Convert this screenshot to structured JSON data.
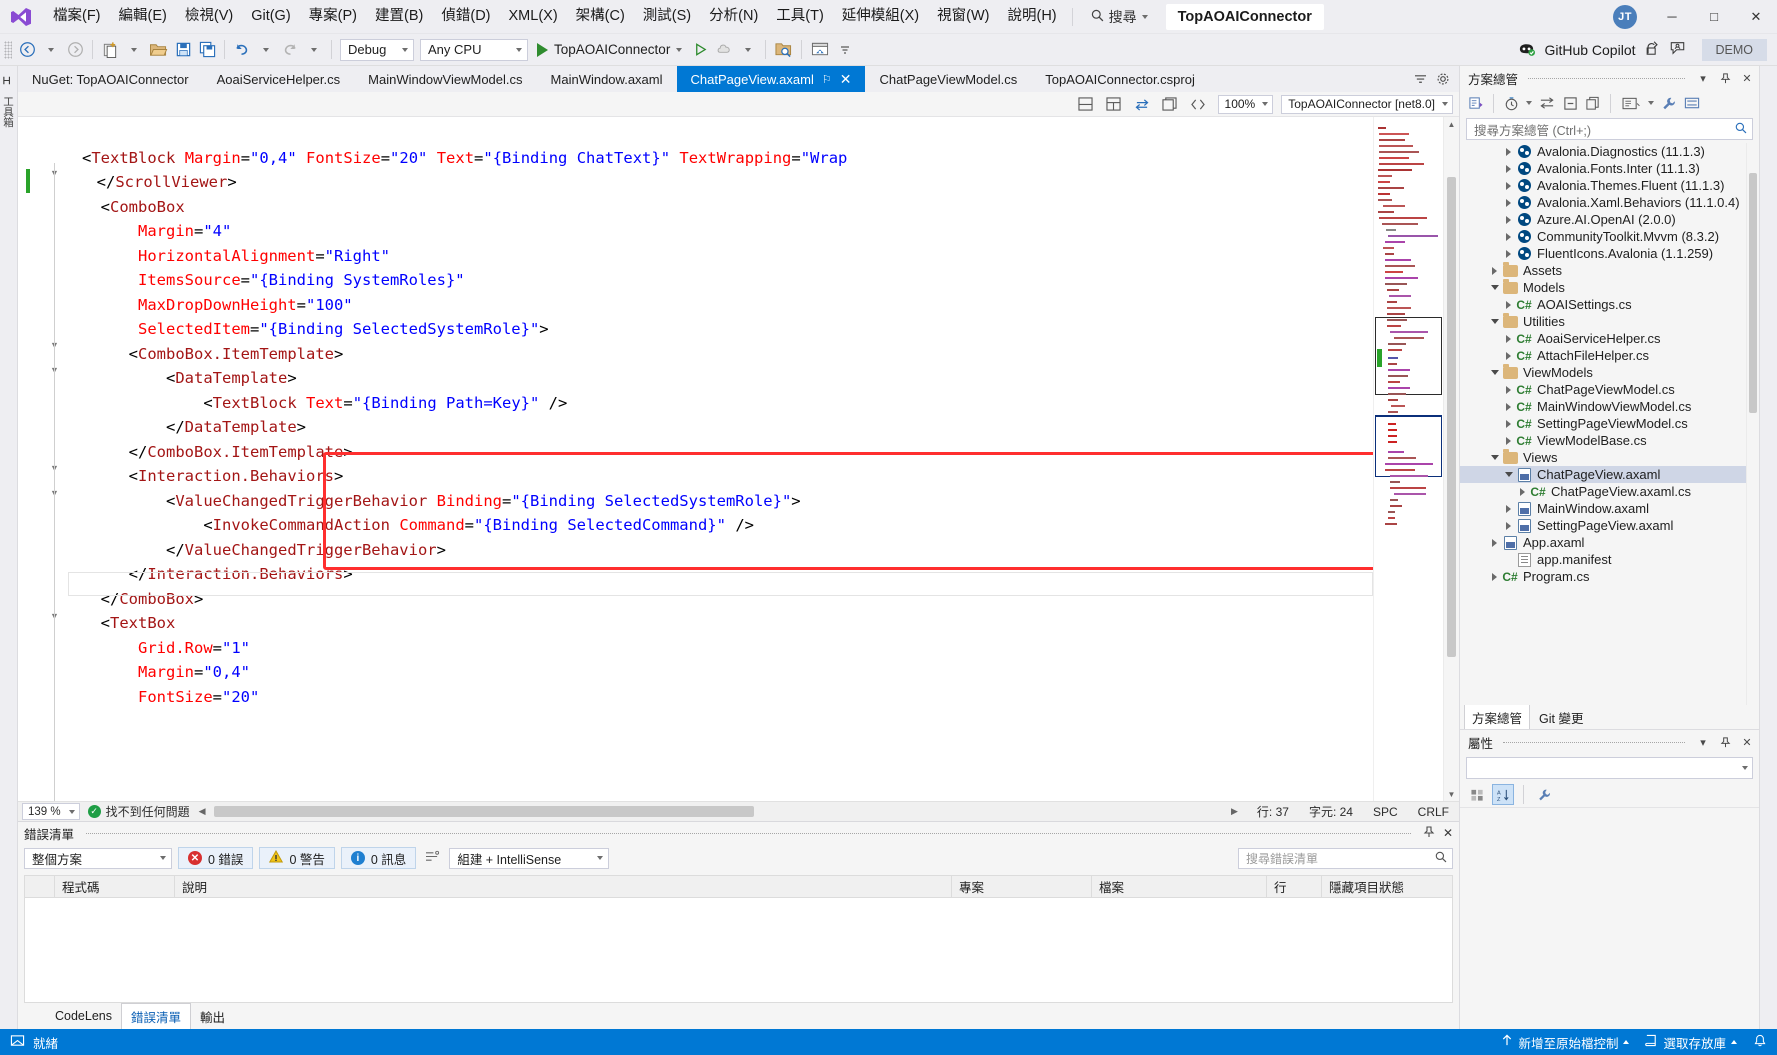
{
  "window": {
    "solution_name": "TopAOAIConnector",
    "avatar_initials": "JT",
    "minimize": "─",
    "maximize": "□",
    "close": "✕"
  },
  "menu": {
    "items": [
      "檔案(F)",
      "編輯(E)",
      "檢視(V)",
      "Git(G)",
      "專案(P)",
      "建置(B)",
      "偵錯(D)",
      "XML(X)",
      "架構(C)",
      "測試(S)",
      "分析(N)",
      "工具(T)",
      "延伸模組(X)",
      "視窗(W)",
      "說明(H)"
    ],
    "search_label": "搜尋"
  },
  "toolbar": {
    "configuration": "Debug",
    "platform": "Any CPU",
    "run_target": "TopAOAIConnector",
    "copilot_label": "GitHub Copilot",
    "demo_label": "DEMO"
  },
  "tabs": {
    "items": [
      {
        "label": "NuGet: TopAOAIConnector",
        "active": false
      },
      {
        "label": "AoaiServiceHelper.cs",
        "active": false
      },
      {
        "label": "MainWindowViewModel.cs",
        "active": false
      },
      {
        "label": "MainWindow.axaml",
        "active": false
      },
      {
        "label": "ChatPageView.axaml",
        "active": true,
        "pin": "⚐",
        "close": "✕"
      },
      {
        "label": "ChatPageViewModel.cs",
        "active": false
      },
      {
        "label": "TopAOAIConnector.csproj",
        "active": false
      }
    ]
  },
  "editor_toolbar": {
    "zoom": "100%",
    "namespace": "TopAOAIConnector [net8.0]"
  },
  "code": {
    "lines": [
      "        <TextBlock Margin=\"0,4\" FontSize=\"20\" Text=\"{Binding ChatText}\" TextWrapping=\"Wrap",
      "    </ScrollViewer>",
      "    <ComboBox",
      "        Margin=\"4\"",
      "        HorizontalAlignment=\"Right\"",
      "        ItemsSource=\"{Binding SystemRoles}\"",
      "        MaxDropDownHeight=\"100\"",
      "        SelectedItem=\"{Binding SelectedSystemRole}\">",
      "        <ComboBox.ItemTemplate>",
      "            <DataTemplate>",
      "                <TextBlock Text=\"{Binding Path=Key}\" />",
      "            </DataTemplate>",
      "        </ComboBox.ItemTemplate>",
      "        <Interaction.Behaviors>",
      "            <ValueChangedTriggerBehavior Binding=\"{Binding SelectedSystemRole}\">",
      "                <InvokeCommandAction Command=\"{Binding SelectedCommand}\" />",
      "            </ValueChangedTriggerBehavior>",
      "        </Interaction.Behaviors>",
      "    </ComboBox>",
      "    <TextBox",
      "        Grid.Row=\"1\"",
      "        Margin=\"0,4\"",
      "        FontSize=\"20\""
    ]
  },
  "editor_status": {
    "zoom": "139 %",
    "message": "找不到任何問題",
    "line_label": "行: 37",
    "col_label": "字元: 24",
    "spaces": "SPC",
    "line_ending": "CRLF"
  },
  "error_list": {
    "title": "錯誤清單",
    "scope": "整個方案",
    "errors": "0 錯誤",
    "warnings": "0 警告",
    "messages": "0 訊息",
    "build_filter": "組建 + IntelliSense",
    "search_placeholder": "搜尋錯誤清單",
    "columns": [
      "",
      "程式碼",
      "說明",
      "專案",
      "檔案",
      "行",
      "隱藏項目狀態"
    ],
    "rows": []
  },
  "bottom_tabs": {
    "items": [
      {
        "label": "CodeLens",
        "active": false
      },
      {
        "label": "錯誤清單",
        "active": true
      },
      {
        "label": "輸出",
        "active": false
      }
    ]
  },
  "solution_explorer": {
    "title": "方案總管",
    "search_placeholder": "搜尋方案總管 (Ctrl+;)",
    "tree": [
      {
        "label": "Avalonia.Diagnostics (11.1.3)",
        "indent": 3,
        "icon": "nuget-icon",
        "arrow": "closed"
      },
      {
        "label": "Avalonia.Fonts.Inter (11.1.3)",
        "indent": 3,
        "icon": "nuget-icon",
        "arrow": "closed"
      },
      {
        "label": "Avalonia.Themes.Fluent (11.1.3)",
        "indent": 3,
        "icon": "nuget-icon",
        "arrow": "closed"
      },
      {
        "label": "Avalonia.Xaml.Behaviors (11.1.0.4)",
        "indent": 3,
        "icon": "nuget-icon",
        "arrow": "closed"
      },
      {
        "label": "Azure.AI.OpenAI (2.0.0)",
        "indent": 3,
        "icon": "nuget-icon",
        "arrow": "closed"
      },
      {
        "label": "CommunityToolkit.Mvvm (8.3.2)",
        "indent": 3,
        "icon": "nuget-icon",
        "arrow": "closed"
      },
      {
        "label": "FluentIcons.Avalonia (1.1.259)",
        "indent": 3,
        "icon": "nuget-icon",
        "arrow": "closed"
      },
      {
        "label": "Assets",
        "indent": 2,
        "icon": "folder-icon",
        "arrow": "closed"
      },
      {
        "label": "Models",
        "indent": 2,
        "icon": "folder-icon",
        "arrow": "open"
      },
      {
        "label": "AOAISettings.cs",
        "indent": 3,
        "icon": "csharp-icon",
        "arrow": "closed"
      },
      {
        "label": "Utilities",
        "indent": 2,
        "icon": "folder-icon",
        "arrow": "open"
      },
      {
        "label": "AoaiServiceHelper.cs",
        "indent": 3,
        "icon": "csharp-icon",
        "arrow": "closed"
      },
      {
        "label": "AttachFileHelper.cs",
        "indent": 3,
        "icon": "csharp-icon",
        "arrow": "closed"
      },
      {
        "label": "ViewModels",
        "indent": 2,
        "icon": "folder-icon",
        "arrow": "open"
      },
      {
        "label": "ChatPageViewModel.cs",
        "indent": 3,
        "icon": "csharp-icon",
        "arrow": "closed"
      },
      {
        "label": "MainWindowViewModel.cs",
        "indent": 3,
        "icon": "csharp-icon",
        "arrow": "closed"
      },
      {
        "label": "SettingPageViewModel.cs",
        "indent": 3,
        "icon": "csharp-icon",
        "arrow": "closed"
      },
      {
        "label": "ViewModelBase.cs",
        "indent": 3,
        "icon": "csharp-icon",
        "arrow": "closed"
      },
      {
        "label": "Views",
        "indent": 2,
        "icon": "folder-icon",
        "arrow": "open"
      },
      {
        "label": "ChatPageView.axaml",
        "indent": 3,
        "icon": "xaml-icon",
        "arrow": "open",
        "selected": true
      },
      {
        "label": "ChatPageView.axaml.cs",
        "indent": 4,
        "icon": "csharp-icon",
        "arrow": "closed"
      },
      {
        "label": "MainWindow.axaml",
        "indent": 3,
        "icon": "xaml-icon",
        "arrow": "closed"
      },
      {
        "label": "SettingPageView.axaml",
        "indent": 3,
        "icon": "xaml-icon",
        "arrow": "closed"
      },
      {
        "label": "App.axaml",
        "indent": 2,
        "icon": "xaml-icon",
        "arrow": "closed"
      },
      {
        "label": "app.manifest",
        "indent": 3,
        "icon": "manifest-icon",
        "arrow": "none"
      },
      {
        "label": "Program.cs",
        "indent": 2,
        "icon": "csharp-icon",
        "arrow": "closed"
      }
    ],
    "tabs": [
      {
        "label": "方案總管",
        "active": true
      },
      {
        "label": "Git 變更",
        "active": false
      }
    ]
  },
  "properties": {
    "title": "屬性"
  },
  "statusbar": {
    "status": "就緒",
    "add_to_source_control": "新增至原始檔控制",
    "select_repository": "選取存放庫"
  },
  "left_rail": {
    "label": "工具箱"
  },
  "colors": {
    "accent": "#0078d4",
    "tab_active": "#0078d4",
    "highlight_box": "#ff2f2f",
    "chrome": "#eeeef2"
  }
}
